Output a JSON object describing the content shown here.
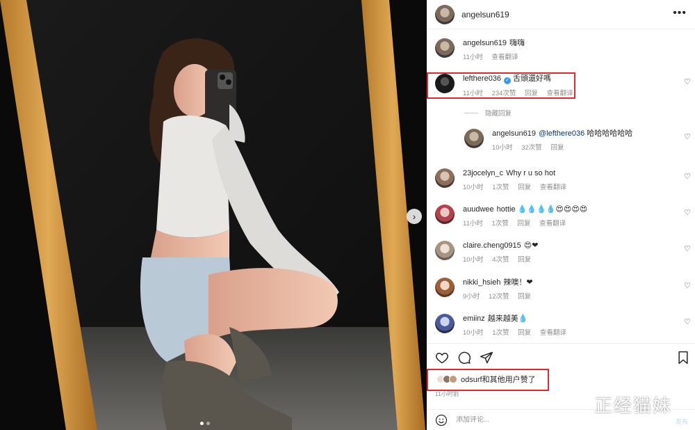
{
  "post": {
    "author": "angelsun619",
    "next_icon": "chevron-right-icon",
    "carousel_dots": 2
  },
  "header": {
    "username": "angelsun619",
    "more_icon": "more-horizontal-icon"
  },
  "caption": {
    "username": "angelsun619",
    "text": "嗨嗨",
    "time": "11小时",
    "translate": "查看翻译"
  },
  "comments": [
    {
      "username": "lefthere036",
      "verified": true,
      "text": "舌頭還好嗎",
      "time": "11小时",
      "likes": "234次赞",
      "reply": "回复",
      "translate": "查看翻译",
      "highlighted": true
    },
    {
      "username": "23jocelyn_c",
      "text": "Why r u so hot",
      "time": "10小时",
      "likes": "1次赞",
      "reply": "回复",
      "translate": "查看翻译"
    },
    {
      "username": "auudwee",
      "text": "hottie 💧💧💧💧😍😍😍😍",
      "time": "11小时",
      "likes": "1次赞",
      "reply": "回复",
      "translate": "查看翻译"
    },
    {
      "username": "claire.cheng0915",
      "text": "😍❤",
      "time": "10小时",
      "likes": "4次赞",
      "reply": "回复"
    },
    {
      "username": "nikki_hsieh",
      "text": "辣噢！❤",
      "time": "9小时",
      "likes": "12次赞",
      "reply": "回复"
    },
    {
      "username": "emiinz",
      "text": "越来越美💧",
      "time": "10小时",
      "likes": "1次赞",
      "reply": "回复",
      "translate": "查看翻译"
    }
  ],
  "hide_replies": "隐藏回复",
  "reply": {
    "username": "angelsun619",
    "mention": "@lefthere036",
    "text": "哈哈哈哈哈哈",
    "time": "10小时",
    "likes": "32次赞",
    "reply": "回复"
  },
  "actions": {
    "like_icon": "heart-icon",
    "comment_icon": "comment-icon",
    "share_icon": "send-icon",
    "save_icon": "bookmark-icon"
  },
  "likes_summary": "odsurf和其他用户赞了",
  "posted_time": "11小时前",
  "add_comment": {
    "placeholder": "添加评论...",
    "emoji_icon": "smile-icon",
    "post_label": "发布"
  },
  "watermark": "正经猫妹",
  "colors": {
    "highlight": "#e8262b",
    "verified": "#3897f0",
    "frame": "#d9a04a"
  }
}
